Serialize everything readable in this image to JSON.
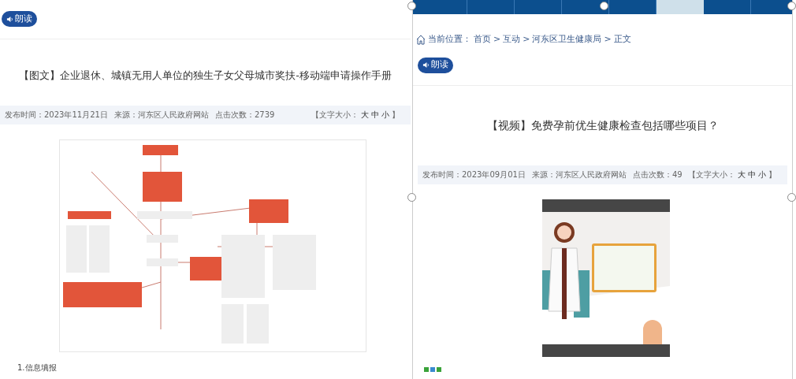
{
  "left_article": {
    "read_button": "朗读",
    "title": "【图文】企业退休、城镇无用人单位的独生子女父母城市奖扶-移动端申请操作手册",
    "meta": {
      "publish_time": "发布时间：2023年11月21日",
      "source": "来源：河东区人民政府网站",
      "clicks": "点击次数：2739",
      "font_size_prefix": "【文字大小：",
      "font_sizes": [
        "大",
        "中",
        "小"
      ],
      "font_size_suffix": "】"
    },
    "paragraph": "1.信息填报"
  },
  "right_article": {
    "nav_tabs": [
      {
        "selected": false
      },
      {
        "selected": false
      },
      {
        "selected": false
      },
      {
        "selected": false
      },
      {
        "selected": false
      },
      {
        "selected": true
      },
      {
        "selected": false
      }
    ],
    "breadcrumb": {
      "label": "当前位置：",
      "separator": ">",
      "items": [
        "首页",
        "互动",
        "河东区卫生健康局",
        "正文"
      ]
    },
    "read_button": "朗读",
    "title": "【视频】免费孕前优生健康检查包括哪些项目？",
    "meta": {
      "publish_time": "发布时间：2023年09月01日",
      "source": "来源：河东区人民政府网站",
      "clicks": "点击次数：49",
      "font_size_prefix": "【文字大小：",
      "font_sizes": [
        "大",
        "中",
        "小"
      ],
      "font_size_suffix": "】"
    }
  }
}
